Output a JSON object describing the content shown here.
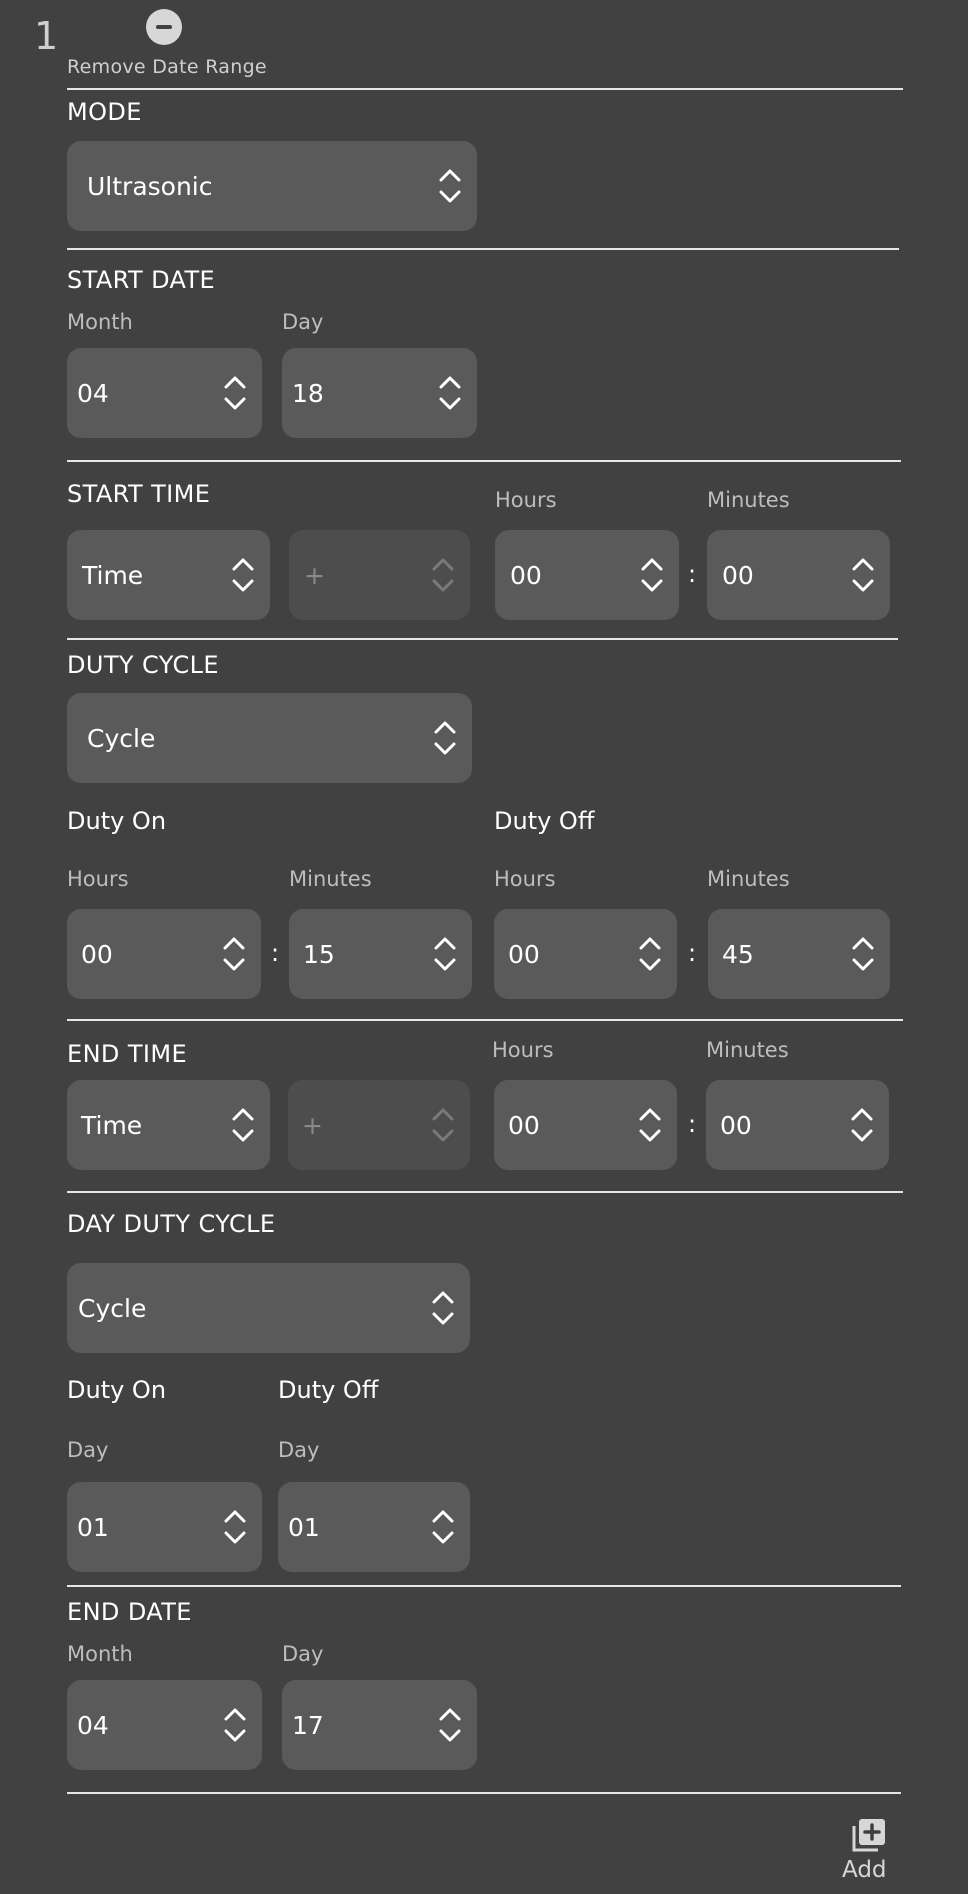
{
  "range_index": "1",
  "remove_label": "Remove Date Range",
  "add_label": "Add",
  "mode": {
    "title": "MODE",
    "value": "Ultrasonic"
  },
  "start_date": {
    "title": "START DATE",
    "month_label": "Month",
    "month": "04",
    "day_label": "Day",
    "day": "18"
  },
  "start_time": {
    "title": "START TIME",
    "type": "Time",
    "offset": "+",
    "hours_label": "Hours",
    "hours": "00",
    "minutes_label": "Minutes",
    "minutes": "00"
  },
  "duty_cycle": {
    "title": "DUTY CYCLE",
    "value": "Cycle",
    "on": {
      "title": "Duty On",
      "hours_label": "Hours",
      "hours": "00",
      "minutes_label": "Minutes",
      "minutes": "15"
    },
    "off": {
      "title": "Duty Off",
      "hours_label": "Hours",
      "hours": "00",
      "minutes_label": "Minutes",
      "minutes": "45"
    }
  },
  "end_time": {
    "title": "END TIME",
    "type": "Time",
    "offset": "+",
    "hours_label": "Hours",
    "hours": "00",
    "minutes_label": "Minutes",
    "minutes": "00"
  },
  "day_duty_cycle": {
    "title": "DAY DUTY CYCLE",
    "value": "Cycle",
    "on": {
      "title": "Duty On",
      "day_label": "Day",
      "day": "01"
    },
    "off": {
      "title": "Duty Off",
      "day_label": "Day",
      "day": "01"
    }
  },
  "end_date": {
    "title": "END DATE",
    "month_label": "Month",
    "month": "04",
    "day_label": "Day",
    "day": "17"
  },
  "colon": ":"
}
